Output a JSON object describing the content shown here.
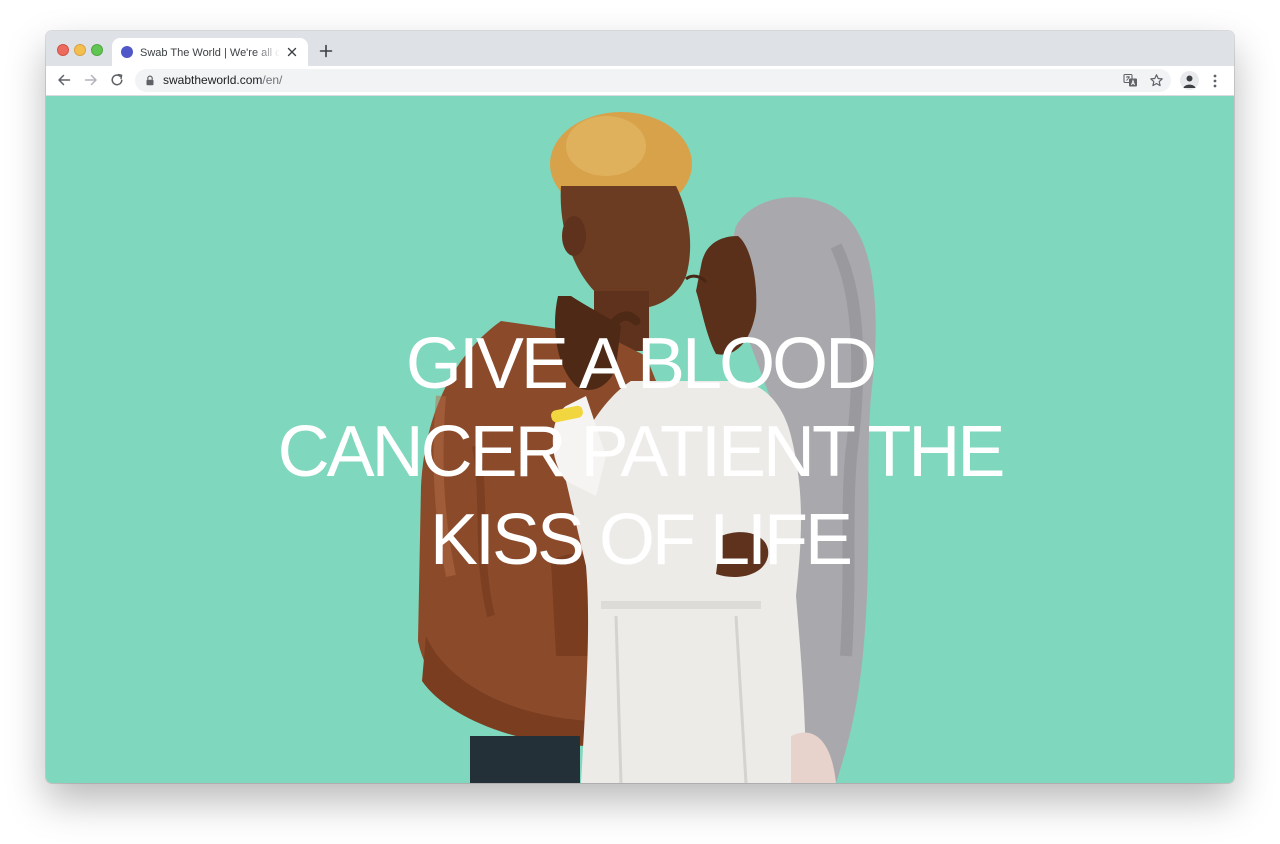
{
  "browser": {
    "tab": {
      "title": "Swab The World | We're all created equal",
      "favicon_color": "#5057c9"
    },
    "url": {
      "host": "swabtheworld.com",
      "path": "/en/"
    },
    "icons": {
      "back": "arrow-left-icon",
      "forward": "arrow-right-icon",
      "reload": "reload-icon",
      "lock": "lock-icon",
      "translate": "translate-icon",
      "bookmark": "star-icon",
      "profile": "avatar",
      "menu": "kebab-menu-icon",
      "new_tab": "plus-icon",
      "close_tab": "close-icon"
    }
  },
  "hero": {
    "background_color": "#7fd7bd",
    "headline_lines": [
      "GIVE A BLOOD",
      "CANCER PATIENT THE",
      "KISS OF LIFE"
    ]
  }
}
